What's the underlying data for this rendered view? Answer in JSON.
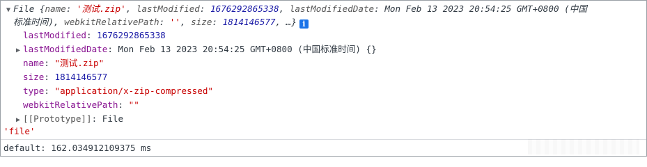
{
  "console": {
    "file_summary": {
      "type_name": "File",
      "open_brace": " {",
      "k_name": "name",
      "v_name": "'测试.zip'",
      "k_lastModified": "lastModified",
      "v_lastModified": "1676292865338",
      "k_lastModifiedDate": "lastModifiedDate",
      "v_lastModifiedDate_part1": "Mon Feb 13 2023 20:54:25 GMT+0800 (中国",
      "v_lastModifiedDate_part2": "标准时间)",
      "k_webkitRelativePath": "webkitRelativePath",
      "v_webkitRelativePath": "''",
      "k_size": "size",
      "v_size": "1814146577",
      "tail": ", …}"
    },
    "properties": [
      {
        "key": "lastModified",
        "value": "1676292865338"
      },
      {
        "key": "lastModifiedDate",
        "value": "Mon Feb 13 2023 20:54:25 GMT+0800 (中国标准时间) {}"
      },
      {
        "key": "name",
        "value": "\"测试.zip\""
      },
      {
        "key": "size",
        "value": "1814146577"
      },
      {
        "key": "type",
        "value": "\"application/x-zip-compressed\""
      },
      {
        "key": "webkitRelativePath",
        "value": "\"\""
      },
      {
        "key": "[[Prototype]]",
        "value": "File"
      }
    ],
    "log_string": "'file'",
    "timer_line": "default: 162.034912109375 ms"
  }
}
